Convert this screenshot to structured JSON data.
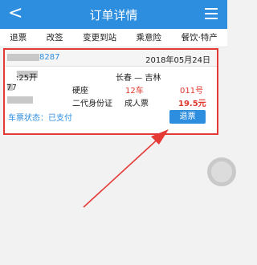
{
  "header": {
    "title": "订单详情",
    "back_icon": "back-chevron-icon",
    "menu_icon": "menu-list-icon"
  },
  "actions": [
    "退票",
    "改签",
    "变更到站",
    "乘意险",
    "餐饮·特产"
  ],
  "order": {
    "order_no": "8287",
    "order_date": "2018年05月24日",
    "depart_prefix": "2018",
    "depart_suffix": ":25开",
    "route": "长春 — 吉林",
    "train_prefix": "K7",
    "train_suffix": "7",
    "seat_type": "硬座",
    "carriage": "12车",
    "seat_no": "011号",
    "id_type": "二代身份证",
    "ticket_type": "成人票",
    "price": "19.5元",
    "status": "车票状态：已支付",
    "refund_button": "退票"
  },
  "colors": {
    "brand": "#2d8ddf",
    "highlight_red": "#e53935",
    "price_red": "#e0352b"
  }
}
